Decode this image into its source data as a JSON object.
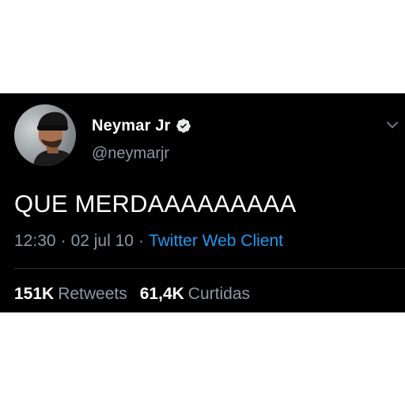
{
  "author": {
    "display_name": "Neymar Jr",
    "handle": "@neymarjr",
    "verified_icon": "verified-badge-icon",
    "avatar_icon": "profile-avatar"
  },
  "tweet": {
    "text": "QUE MERDAAAAAAAAA",
    "time": "12:30",
    "date": "02 jul 10",
    "separator": "·",
    "client": "Twitter Web Client"
  },
  "stats": {
    "retweets_count": "151K",
    "retweets_label": "Retweets",
    "likes_count": "61,4K",
    "likes_label": "Curtidas"
  },
  "menu_icon": "chevron-down-icon",
  "colors": {
    "background": "#000000",
    "text_primary": "#ffffff",
    "text_secondary": "#8b98a5",
    "link": "#1d9bf0",
    "verified_badge": "#e7e9ea",
    "divider": "#2f3336"
  }
}
